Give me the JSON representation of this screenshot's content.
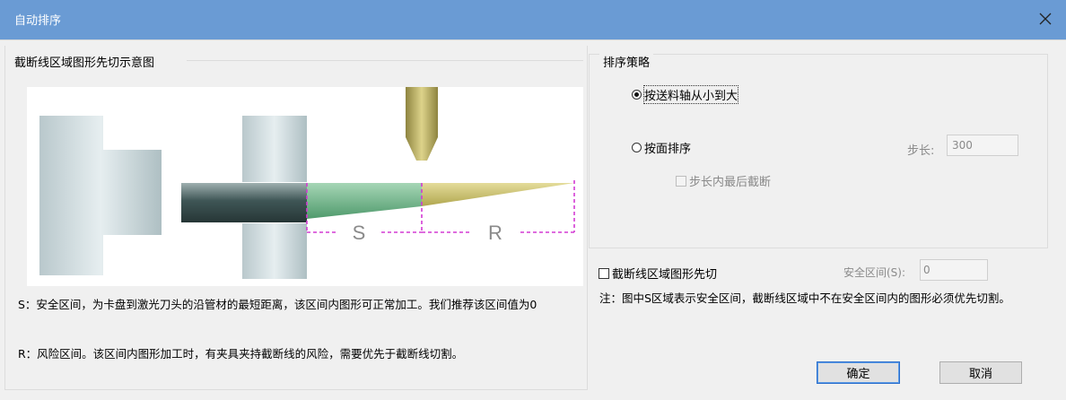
{
  "window": {
    "title": "自动排序",
    "close_icon": "close-icon"
  },
  "left_panel": {
    "title": "截断线区域图形先切示意图",
    "figure": {
      "label_s": "S",
      "label_r": "R",
      "colors": {
        "chuck": "#c6d3d6",
        "tube": "#4f6a6a",
        "safe_zone": "#6fb58a",
        "risk_zone": "#c9c070",
        "nozzle": "#b5a84f",
        "dash": "#d33bd3"
      }
    },
    "note_s": "S：安全区间，为卡盘到激光刀头的沿管材的最短距离，该区间内图形可正常加工。我们推荐该区间值为0",
    "note_r": "R：风险区间。该区间内图形加工时，有夹具夹持截断线的风险，需要优先于截断线切割。"
  },
  "strategy": {
    "title": "排序策略",
    "option_feed": {
      "label": "按送料轴从小到大",
      "checked": true
    },
    "option_face": {
      "label": "按面排序",
      "checked": false
    },
    "step_label": "步长:",
    "step_value": "300",
    "last_cut_in_step": {
      "label": "步长内最后截断",
      "checked": false
    }
  },
  "cut_first": {
    "label": "截断线区域图形先切",
    "checked": false,
    "safe_label": "安全区间(S):",
    "safe_value": "0",
    "note": "注：图中S区域表示安全区间，截断线区域中不在安全区间内的图形必须优先切割。"
  },
  "buttons": {
    "ok": "确定",
    "cancel": "取消"
  }
}
